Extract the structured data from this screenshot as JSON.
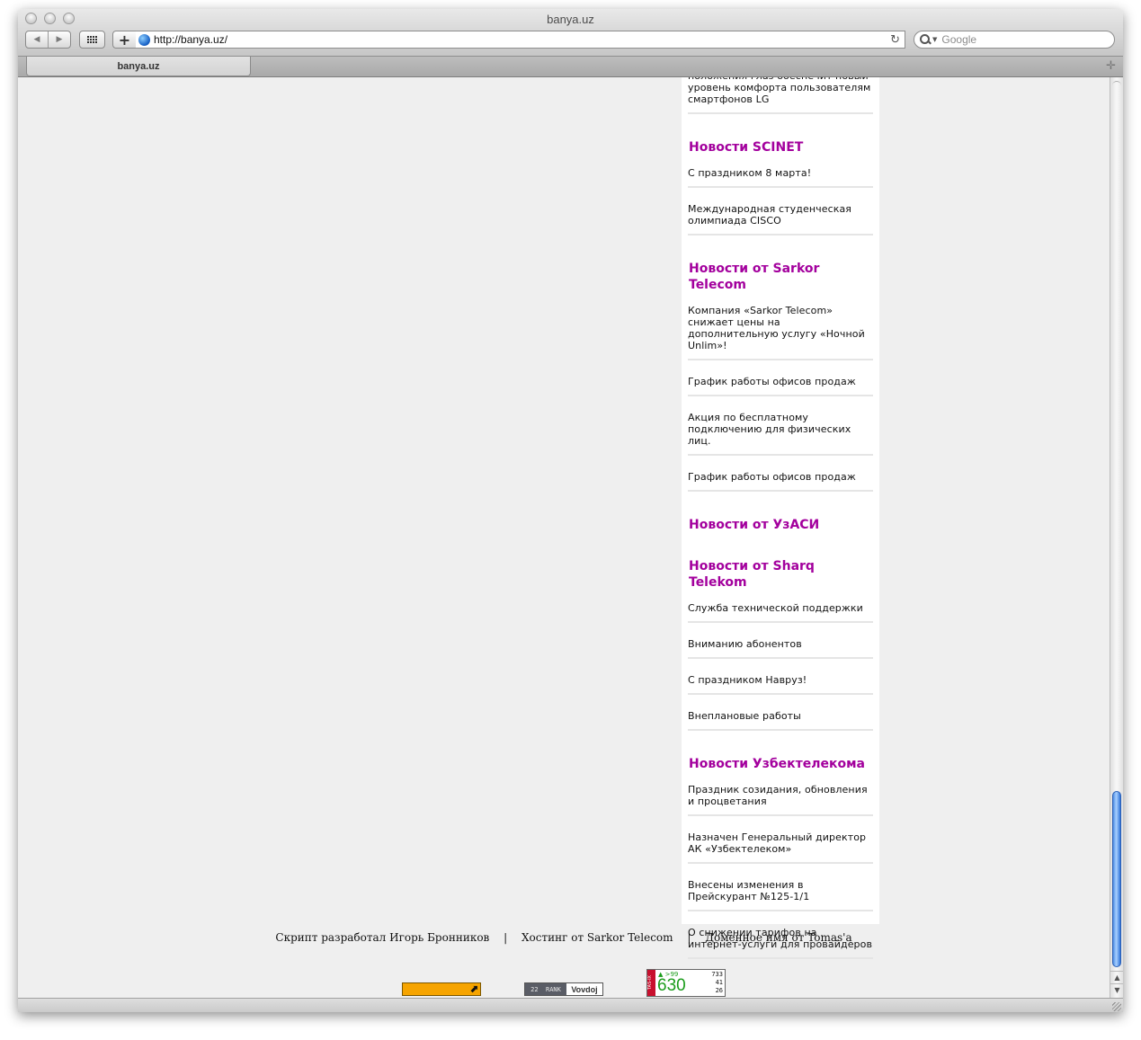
{
  "window": {
    "title": "banya.uz",
    "url": "http://banya.uz/",
    "search_placeholder": "Google",
    "tab_label": "banya.uz"
  },
  "icons": {
    "back": "back-arrow-icon",
    "forward": "forward-arrow-icon",
    "top_sites": "grid-icon",
    "add_bookmark": "plus-icon",
    "site": "globe-icon",
    "reload": "reload-icon",
    "search": "search-icon",
    "new_tab": "plus-icon"
  },
  "sidebar": {
    "truncated_item": "положения глаз обеспечит новый уровень комфорта пользователям смартфонов LG",
    "sections": [
      {
        "title": "Новости SCINET",
        "items": [
          "С праздником 8 марта!",
          "Международная студенческая олимпиада CISCO"
        ]
      },
      {
        "title": "Новости от Sarkor Telecom",
        "items": [
          "Компания «Sarkor Telecom» снижает цены на дополнительную услугу «Ночной Unlim»!",
          "График работы офисов продаж",
          "Акция по бесплатному подключению для физических лиц.",
          "График работы офисов продаж"
        ]
      },
      {
        "title": "Новости от УзАСИ",
        "items": []
      },
      {
        "title": "Новости от Sharq Telekom",
        "items": [
          "Служба технической поддержки",
          "Вниманию абонентов",
          "С праздником Навруз!",
          "Внеплановые работы"
        ]
      },
      {
        "title": "Новости Узбектелекома",
        "items": [
          "Праздник созидания, обновления и процветания",
          "Назначен Генеральный директор АК «Узбектелеком»",
          "Внесены изменения в Прейскурант №125-1/1",
          "О снижении тарифов на интернет-услуги для провайдеров"
        ]
      }
    ]
  },
  "footer": {
    "credit_script": "Скрипт разработал Игорь Бронников",
    "separator": "|",
    "credit_hosting": "Хостинг от Sarkor Telecom",
    "credit_domain": "Доменное имя от Tomas'a"
  },
  "counters": {
    "rank_number": "22",
    "rank_label": "RANK",
    "rank_brand": "Vovdoj",
    "tas_label": "TAS-IX",
    "tas_up": "▲ >99",
    "tas_big": "630",
    "tas_n1": "733",
    "tas_n2": "41",
    "tas_n3": "26"
  },
  "colors": {
    "section_title": "#a3009d",
    "page_bg": "#efefef",
    "scroll_thumb": "#4f8fe6"
  },
  "scrollbar": {
    "scroll_position_fraction": 0.95
  }
}
